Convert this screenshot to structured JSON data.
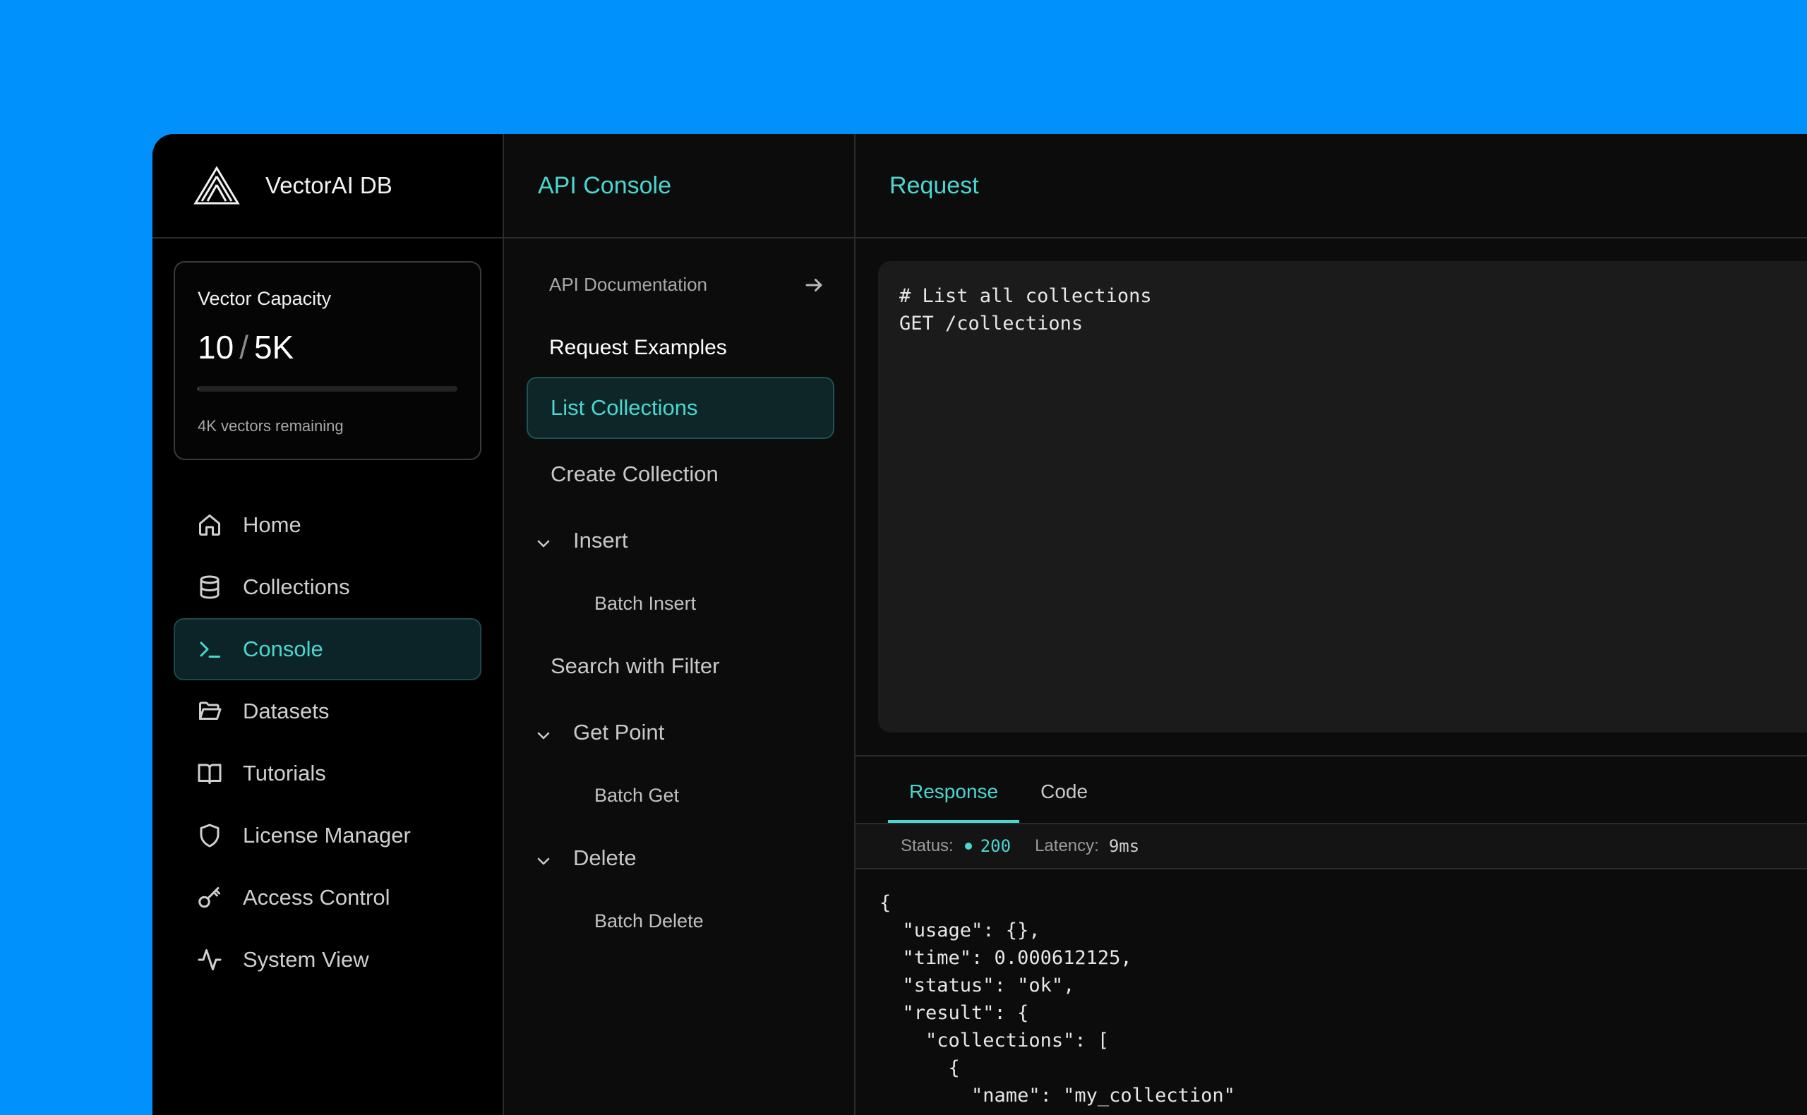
{
  "app": {
    "name": "VectorAI DB",
    "logo_icon": "vectorai-logo-icon",
    "accent_color": "#4ad7d1",
    "background_color": "#0091fc"
  },
  "capacity": {
    "title": "Vector Capacity",
    "used": "10",
    "separator": "/",
    "total": "5K",
    "remaining_text": "4K vectors remaining",
    "fill_fraction": 0.002
  },
  "nav": {
    "items": [
      {
        "label": "Home",
        "icon": "home-icon"
      },
      {
        "label": "Collections",
        "icon": "database-icon"
      },
      {
        "label": "Console",
        "icon": "terminal-icon",
        "active": true
      },
      {
        "label": "Datasets",
        "icon": "folder-open-icon"
      },
      {
        "label": "Tutorials",
        "icon": "book-open-icon"
      },
      {
        "label": "License Manager",
        "icon": "shield-icon"
      },
      {
        "label": "Access Control",
        "icon": "key-icon"
      },
      {
        "label": "System View",
        "icon": "activity-icon"
      }
    ]
  },
  "console": {
    "title": "API Console",
    "doc_link": "API Documentation",
    "doc_link_icon": "arrow-right-icon",
    "examples_heading": "Request Examples",
    "examples": [
      {
        "label": "List Collections",
        "type": "item",
        "active": true
      },
      {
        "label": "Create Collection",
        "type": "item"
      },
      {
        "label": "Insert",
        "type": "group"
      },
      {
        "label": "Batch Insert",
        "type": "sub"
      },
      {
        "label": "Search with Filter",
        "type": "item"
      },
      {
        "label": "Get Point",
        "type": "group"
      },
      {
        "label": "Batch Get",
        "type": "sub"
      },
      {
        "label": "Delete",
        "type": "group"
      },
      {
        "label": "Batch Delete",
        "type": "sub"
      }
    ]
  },
  "request": {
    "title": "Request",
    "body": "# List all collections\nGET /collections"
  },
  "response": {
    "tabs": [
      {
        "label": "Response",
        "active": true
      },
      {
        "label": "Code"
      }
    ],
    "status_label": "Status:",
    "status_code": "200",
    "latency_label": "Latency:",
    "latency_value": "9ms",
    "body": "{\n  \"usage\": {},\n  \"time\": 0.000612125,\n  \"status\": \"ok\",\n  \"result\": {\n    \"collections\": [\n      {\n        \"name\": \"my_collection\""
  }
}
